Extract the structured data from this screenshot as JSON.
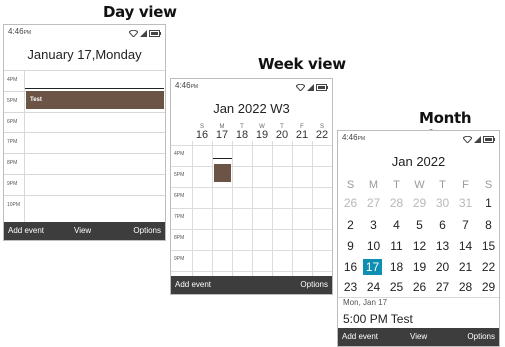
{
  "titles": {
    "day": "Day view",
    "week": "Week view",
    "month": "Month view"
  },
  "status": {
    "time": "4:46",
    "ampm": "PM"
  },
  "day": {
    "header": "January 17,Monday",
    "hours": [
      "4PM",
      "5PM",
      "6PM",
      "7PM",
      "8PM",
      "9PM",
      "10PM"
    ],
    "event": "Test",
    "softkeys": {
      "left": "Add event",
      "center": "View",
      "right": "Options"
    }
  },
  "week": {
    "header": "Jan 2022 W3",
    "days": [
      {
        "d": "S",
        "n": "16"
      },
      {
        "d": "M",
        "n": "17"
      },
      {
        "d": "T",
        "n": "18"
      },
      {
        "d": "W",
        "n": "19"
      },
      {
        "d": "T",
        "n": "20"
      },
      {
        "d": "F",
        "n": "21"
      },
      {
        "d": "S",
        "n": "22"
      }
    ],
    "hours": [
      "4PM",
      "5PM",
      "6PM",
      "7PM",
      "8PM",
      "9PM"
    ],
    "softkeys": {
      "left": "Add event",
      "right": "Options"
    }
  },
  "month": {
    "header": "Jan 2022",
    "weekdays": [
      "S",
      "M",
      "T",
      "W",
      "T",
      "F",
      "S"
    ],
    "weeks": [
      [
        "26",
        "27",
        "28",
        "29",
        "30",
        "31",
        "1"
      ],
      [
        "2",
        "3",
        "4",
        "5",
        "6",
        "7",
        "8"
      ],
      [
        "9",
        "10",
        "11",
        "12",
        "13",
        "14",
        "15"
      ],
      [
        "16",
        "17",
        "18",
        "19",
        "20",
        "21",
        "22"
      ],
      [
        "23",
        "24",
        "25",
        "26",
        "27",
        "28",
        "29"
      ]
    ],
    "selected_date": "Mon, Jan 17",
    "selected_event": "5:00 PM Test",
    "softkeys": {
      "left": "Add event",
      "center": "View",
      "right": "Options"
    }
  },
  "colors": {
    "event": "#6b5446",
    "selected": "#0c8fb0",
    "softbar": "#3d3d3d"
  },
  "icons": [
    "wifi-icon",
    "signal-icon",
    "battery-icon"
  ]
}
